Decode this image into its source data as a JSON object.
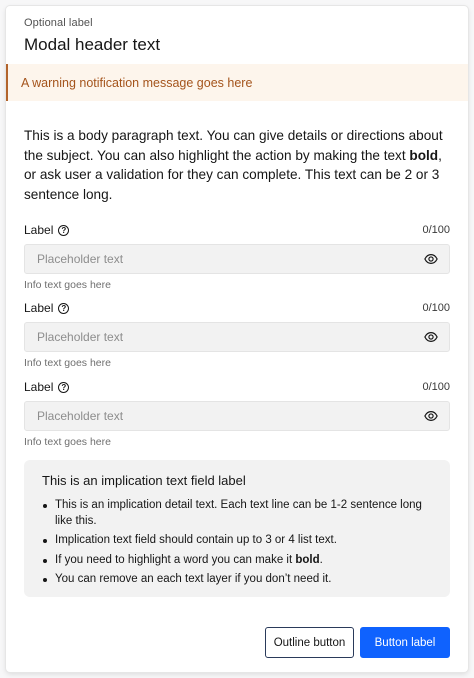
{
  "header": {
    "optional_label": "Optional label",
    "title": "Modal header text"
  },
  "warning": {
    "message": "A warning notification message goes here"
  },
  "body": {
    "part1": "This is a body paragraph text. You can give details or directions about the subject. You can also highlight the action by making the text ",
    "bold": "bold",
    "part2": ", or ask user a validation for they can complete. This text can be 2 or 3 sentence long."
  },
  "fields": [
    {
      "label": "Label",
      "counter": "0/100",
      "placeholder": "Placeholder text",
      "value": "",
      "info": "Info text goes here"
    },
    {
      "label": "Label",
      "counter": "0/100",
      "placeholder": "Placeholder text",
      "value": "",
      "info": "Info text goes here"
    },
    {
      "label": "Label",
      "counter": "0/100",
      "placeholder": "Placeholder text",
      "value": "",
      "info": "Info text goes here"
    }
  ],
  "implication": {
    "title": "This is an implication text field label",
    "items": [
      {
        "text": "This is an implication detail text. Each text line can be 1-2 sentence long like this."
      },
      {
        "text": "Implication text field should contain up to 3 or 4 list text."
      },
      {
        "part1": "If you need to highlight a word you can make it ",
        "bold": "bold",
        "part2": "."
      },
      {
        "text": "You can remove an each text layer if you don’t need it."
      }
    ]
  },
  "footer": {
    "outline_label": "Outline button",
    "primary_label": "Button label"
  },
  "icons": {
    "help": "question-circle-icon",
    "visibility": "eye-icon"
  },
  "colors": {
    "primary": "#0f62fe",
    "warning_bg": "#fdf5ec",
    "warning_text": "#a4541c",
    "warning_border": "#b2642d",
    "field_bg": "#f2f2f2"
  }
}
